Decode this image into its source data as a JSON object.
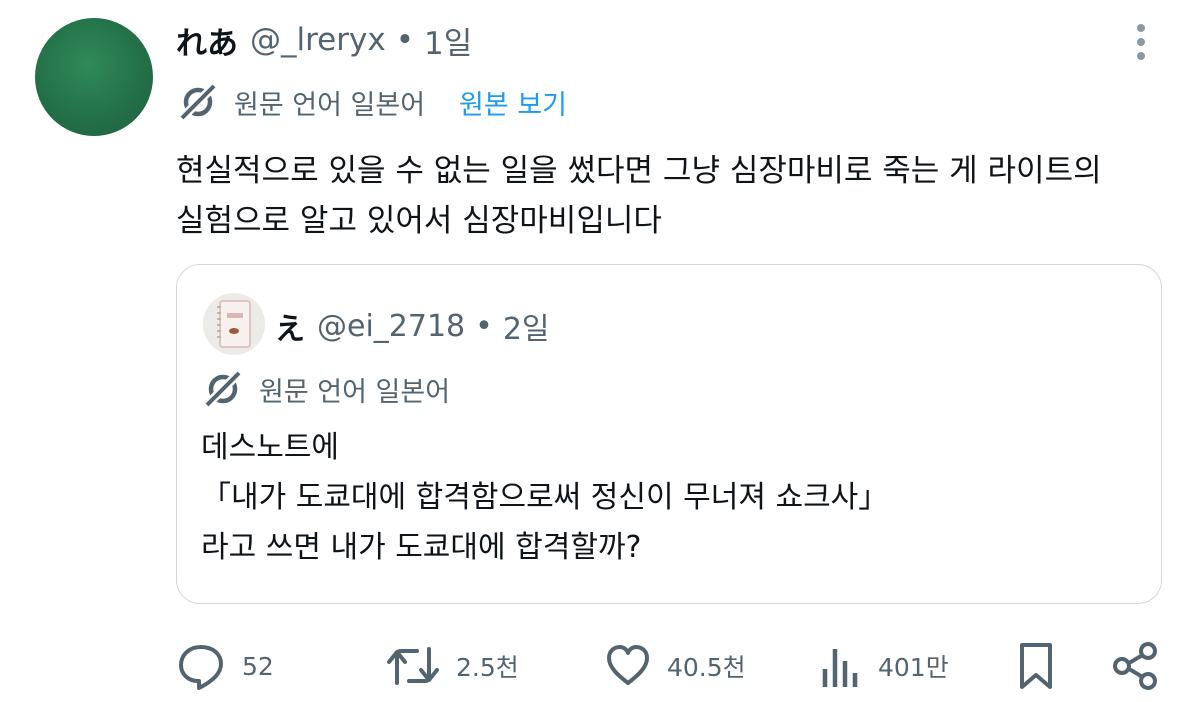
{
  "tweet": {
    "display_name": "れあ",
    "handle": "@_lreryx",
    "separator": "•",
    "time": "1일",
    "lang_label": "원문 언어 일본어",
    "show_original": "원본 보기",
    "text_lines": [
      "현실적으로 있을 수 없는 일을 썼다면 그냥 심장마비로 죽는 게 라이트의",
      "실험으로 알고 있어서 심장마비입니다"
    ]
  },
  "quote": {
    "display_name": "え",
    "handle": "@ei_2718",
    "separator": "•",
    "time": "2일",
    "lang_label": "원문 언어 일본어",
    "text_lines": [
      "데스노트에",
      "「내가 도쿄대에 합격함으로써 정신이 무너져 쇼크사」",
      "라고 쓰면 내가 도쿄대에 합격할까?"
    ]
  },
  "actions": {
    "replies": "52",
    "retweets": "2.5천",
    "likes": "40.5천",
    "views": "401만"
  },
  "icons": {
    "more": "more-vertical-icon",
    "translate": "translate-icon",
    "reply": "reply-icon",
    "retweet": "retweet-icon",
    "like": "heart-icon",
    "views": "views-icon",
    "bookmark": "bookmark-icon",
    "share": "share-icon"
  },
  "colors": {
    "text": "#0f1419",
    "secondary": "#536471",
    "link": "#1d9bf0",
    "border": "#cfd9de",
    "avatar": "#226e47"
  }
}
